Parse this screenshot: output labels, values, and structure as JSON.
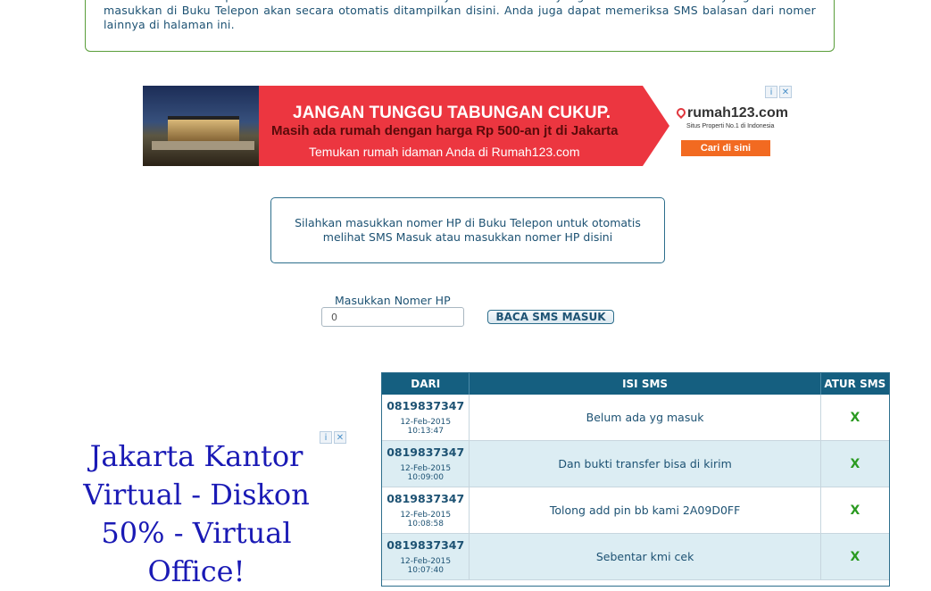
{
  "intro": {
    "text": "Di halaman ini ditampilkan SMS Masuk atau SMS balasannya dari SMS Gratis yang anda kirimkan. Nomer yang telah anda masukkan di Buku Telepon akan secara otomatis ditampilkan disini. Anda juga dapat memeriksa SMS balasan dari nomer lainnya di halaman ini."
  },
  "banner_ad": {
    "headline": "JANGAN TUNGGU TABUNGAN CUKUP.",
    "subheadline": "Masih ada rumah dengan harga Rp 500-an jt di Jakarta",
    "tagline": "Temukan rumah idaman Anda di Rumah123.com",
    "brand": "rumah123.com",
    "brand_sub": "Situs Properti No.1 di Indonesia",
    "cta": "Cari di sini",
    "colors": {
      "red": "#ec3640",
      "orange": "#f26a21"
    }
  },
  "info": {
    "text": "Silahkan masukkan nomer HP di Buku Telepon untuk otomatis melihat SMS Masuk atau masukkan nomer HP disini"
  },
  "form": {
    "label": "Masukkan Nomer HP",
    "value": "0",
    "button": "BACA SMS MASUK"
  },
  "text_ad": {
    "text": "Jakarta Kantor Virtual - Diskon 50% - Virtual Office!"
  },
  "ad_icons": {
    "info": "i",
    "close": "✕"
  },
  "table": {
    "headers": {
      "from": "DARI",
      "content": "ISI SMS",
      "manage": "ATUR SMS"
    },
    "rows": [
      {
        "number": "0819837347",
        "date": "12-Feb-2015 10:13:47",
        "message": "Belum ada yg masuk",
        "action": "X"
      },
      {
        "number": "0819837347",
        "date": "12-Feb-2015 10:09:00",
        "message": "Dan bukti transfer bisa di kirim",
        "action": "X"
      },
      {
        "number": "0819837347",
        "date": "12-Feb-2015 10:08:58",
        "message": "Tolong add pin bb kami 2A09D0FF",
        "action": "X"
      },
      {
        "number": "0819837347",
        "date": "12-Feb-2015 10:07:40",
        "message": "Sebentar kmi cek",
        "action": "X"
      }
    ]
  }
}
